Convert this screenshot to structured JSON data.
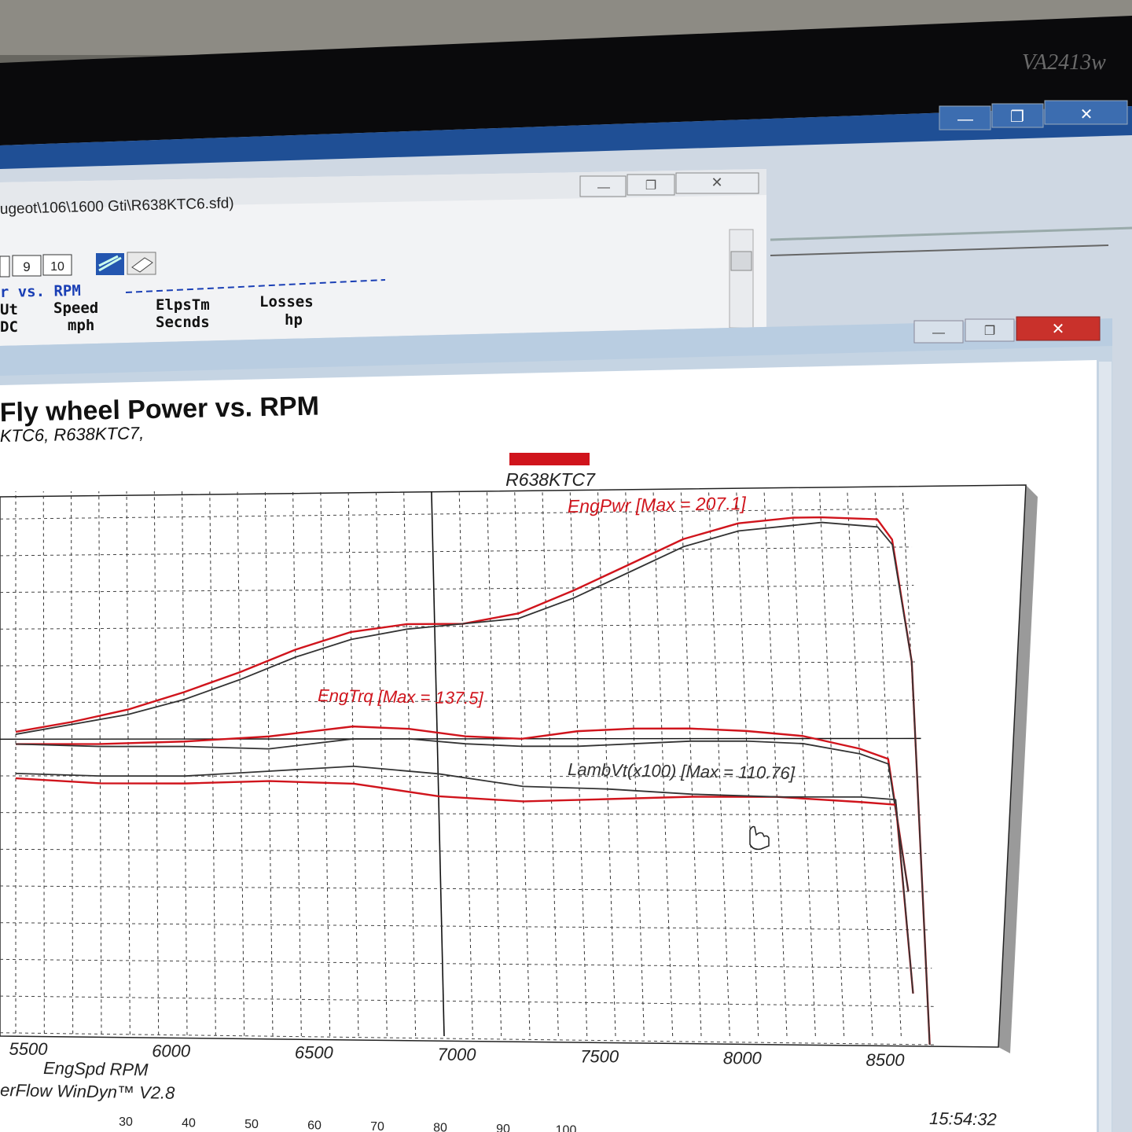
{
  "monitor": {
    "model": "VA2413w"
  },
  "outer_window": {
    "buttons": {
      "minimize": "—",
      "restore": "❐",
      "close": "✕"
    }
  },
  "back_window": {
    "title_path": "ugeot\\106\\1600 Gti\\R638KTC6.sfd)",
    "toolbar_buttons": [
      "",
      "9",
      "10"
    ],
    "report_heading": "r vs. RPM",
    "columns": [
      {
        "name": "Ut",
        "unit": "DC"
      },
      {
        "name": "Speed",
        "unit": "mph"
      },
      {
        "name": "ElpsTm",
        "unit": "Secnds"
      },
      {
        "name": "Losses",
        "unit": "hp"
      }
    ]
  },
  "chart_window": {
    "title": "Fly wheel Power vs. RPM",
    "subtitle": "KTC6, R638KTC7,",
    "footer": "erFlow WinDyn™ V2.8",
    "timestamp": "15:54:32",
    "bottom_ruler": [
      "30",
      "40",
      "50",
      "60",
      "70",
      "80",
      "90",
      "100"
    ]
  },
  "chart_data": {
    "type": "line",
    "xlabel": "EngSpd  RPM",
    "xticks": [
      5500,
      6000,
      6500,
      7000,
      7500,
      8000,
      8500
    ],
    "legend": {
      "label": "R638KTC7",
      "color": "#d0141c",
      "position": "top-center"
    },
    "annotations": [
      {
        "text": "EngPwr [Max = 207.1]",
        "color": "#d0141c"
      },
      {
        "text": "EngTrq [Max = 137.5]",
        "color": "#d0141c"
      },
      {
        "text": "LambVt(x100) [Max = 110.76]",
        "color": "#333333"
      }
    ],
    "colors": {
      "R638KTC7": "#d0141c",
      "R638KTC6": "#333333"
    },
    "grid": true,
    "series": [
      {
        "name": "R638KTC7",
        "measure": "EngPwr",
        "x": [
          5500,
          5700,
          5900,
          6100,
          6300,
          6500,
          6700,
          6900,
          7100,
          7300,
          7500,
          7700,
          7900,
          8100,
          8300,
          8400,
          8600,
          8650,
          8700,
          8700
        ],
        "y": [
          123,
          127,
          132,
          139,
          147,
          156,
          163,
          166,
          166,
          170,
          179,
          189,
          199,
          205,
          207,
          207,
          206,
          198,
          150,
          0
        ]
      },
      {
        "name": "R638KTC6",
        "measure": "EngPwr",
        "x": [
          5500,
          5700,
          5900,
          6100,
          6300,
          6500,
          6700,
          6900,
          7100,
          7300,
          7500,
          7700,
          7900,
          8100,
          8300,
          8400,
          8600,
          8650,
          8700,
          8700
        ],
        "y": [
          122,
          126,
          130,
          136,
          144,
          153,
          160,
          164,
          166,
          168,
          176,
          186,
          196,
          202,
          204,
          205,
          203,
          196,
          150,
          0
        ]
      },
      {
        "name": "R638KTC7",
        "measure": "EngTrq",
        "x": [
          5500,
          5800,
          6100,
          6400,
          6700,
          6900,
          7100,
          7300,
          7500,
          7700,
          7900,
          8100,
          8300,
          8500,
          8600,
          8650
        ],
        "y": [
          118,
          118,
          119,
          121,
          125,
          124,
          121,
          120,
          123,
          124,
          124,
          123,
          121,
          116,
          112,
          60
        ]
      },
      {
        "name": "R638KTC6",
        "measure": "EngTrq",
        "x": [
          5500,
          5800,
          6100,
          6400,
          6700,
          6900,
          7100,
          7300,
          7500,
          7700,
          7900,
          8100,
          8300,
          8500,
          8600,
          8650
        ],
        "y": [
          118,
          117,
          117,
          116,
          120,
          120,
          118,
          117,
          117,
          118,
          119,
          119,
          118,
          114,
          110,
          60
        ]
      },
      {
        "name": "R638KTC7",
        "measure": "LambVt(x100)",
        "x": [
          5500,
          5800,
          6100,
          6400,
          6700,
          7000,
          7300,
          7600,
          7900,
          8200,
          8500,
          8620,
          8650
        ],
        "y": [
          104,
          102,
          102,
          103,
          102,
          97,
          95,
          96,
          97,
          97,
          95,
          94,
          20
        ]
      },
      {
        "name": "R638KTC6",
        "measure": "LambVt(x100)",
        "x": [
          5500,
          5800,
          6100,
          6400,
          6700,
          7000,
          7300,
          7600,
          7900,
          8200,
          8500,
          8620,
          8650
        ],
        "y": [
          106,
          105,
          105,
          107,
          109,
          106,
          101,
          100,
          98,
          97,
          97,
          96,
          20
        ]
      }
    ]
  }
}
